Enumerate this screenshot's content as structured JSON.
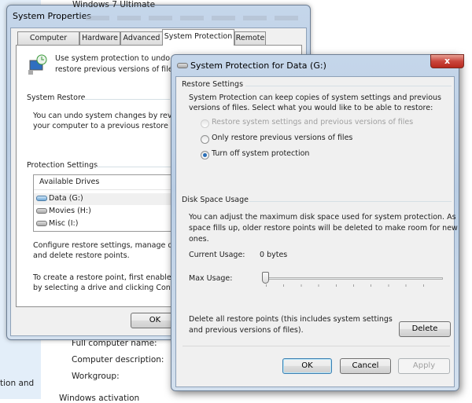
{
  "background": {
    "edition": "Windows 7 Ultimate",
    "labels": [
      "Full computer name:",
      "Computer description:",
      "Workgroup:"
    ],
    "sidebar_text": "tion and",
    "activation": "Windows activation"
  },
  "system_properties": {
    "title": "System Properties",
    "tabs": [
      {
        "label": "Computer Name"
      },
      {
        "label": "Hardware"
      },
      {
        "label": "Advanced"
      },
      {
        "label": "System Protection",
        "selected": true
      },
      {
        "label": "Remote"
      }
    ],
    "intro_line1": "Use system protection to undo un",
    "intro_line2": "restore previous versions of files.",
    "intro_link": "W",
    "system_restore": {
      "heading": "System Restore",
      "line1": "You can undo system changes by revertin",
      "line2": "your computer to a previous restore point."
    },
    "protection_settings": {
      "heading": "Protection Settings",
      "column_header": "Available Drives",
      "drives": [
        {
          "label": "Data (G:)",
          "icon": "drive-icon-blue",
          "selected": true
        },
        {
          "label": "Movies (H:)",
          "icon": "drive-icon"
        },
        {
          "label": "Misc (I:)",
          "icon": "drive-icon"
        }
      ],
      "configure_line1": "Configure restore settings, manage disk s",
      "configure_line2": "and delete restore points.",
      "create_line1": "To create a restore point, first enable prot",
      "create_line2": "by selecting a drive and clicking Configur"
    },
    "ok_label": "OK"
  },
  "dialog": {
    "title": "System Protection for Data (G:)",
    "close_label": "x",
    "restore_settings": {
      "heading": "Restore Settings",
      "line1": "System Protection can keep copies of system settings and previous",
      "line2": "versions of files. Select what you would like to be able to restore:",
      "options": [
        {
          "label": "Restore system settings and previous versions of files",
          "checked": false,
          "disabled": true
        },
        {
          "label": "Only restore previous versions of files",
          "checked": false,
          "disabled": false
        },
        {
          "label": "Turn off system protection",
          "checked": true,
          "disabled": false
        }
      ]
    },
    "disk_space": {
      "heading": "Disk Space Usage",
      "line1": "You can adjust the maximum disk space used for system protection. As",
      "line2": "space fills up, older restore points will be deleted to make room for new",
      "line3": "ones.",
      "current_label": "Current Usage:",
      "current_value": "0 bytes",
      "max_label": "Max Usage:",
      "max_percent": 0
    },
    "delete_line1": "Delete all restore points (this includes system settings",
    "delete_line2": "and previous versions of files).",
    "delete_label": "Delete",
    "ok_label": "OK",
    "cancel_label": "Cancel",
    "apply_label": "Apply"
  },
  "colors": {
    "close_button": "#c9463d",
    "radio_selected": "#2a6fb8",
    "link": "#0066cc"
  }
}
